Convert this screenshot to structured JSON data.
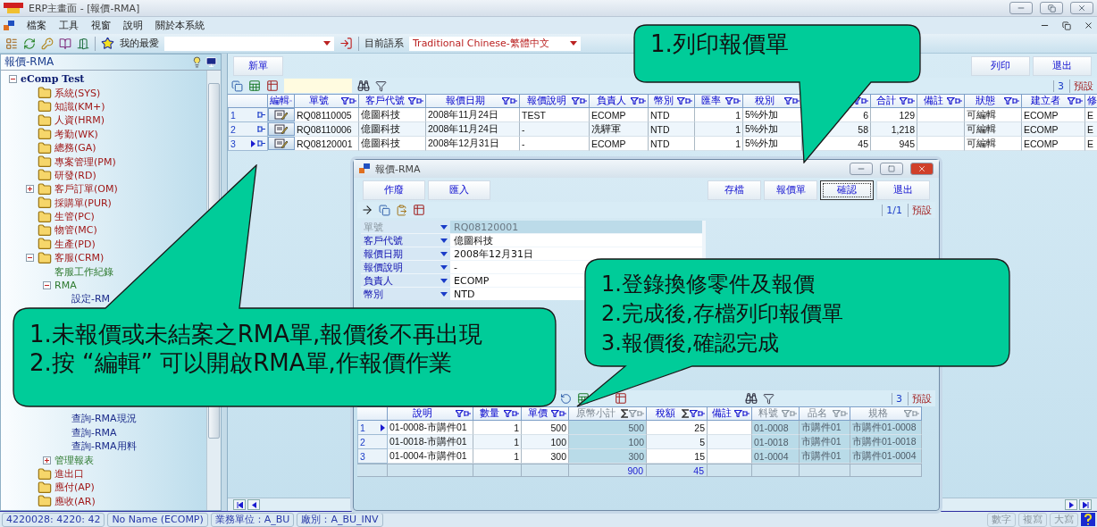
{
  "window": {
    "title": "ERP主畫面 - [報價-RMA]"
  },
  "menu": [
    "檔案",
    "工具",
    "視窗",
    "說明",
    "關於本系統"
  ],
  "toolbar": {
    "favorites_label": "我的最愛",
    "language_label": "目前語系",
    "language": "Traditional Chinese-繁體中文"
  },
  "sidebar": {
    "title": "報價-RMA",
    "tree": [
      {
        "label": "eComp Test",
        "expanded": true,
        "children": [
          {
            "label": "系統(SYS)"
          },
          {
            "label": "知識(KM+)"
          },
          {
            "label": "人資(HRM)"
          },
          {
            "label": "考勤(WK)"
          },
          {
            "label": "總務(GA)"
          },
          {
            "label": "專案管理(PM)"
          },
          {
            "label": "研發(RD)"
          },
          {
            "label": "客戶訂單(OM)",
            "expanded": false
          },
          {
            "label": "採購單(PUR)"
          },
          {
            "label": "生管(PC)"
          },
          {
            "label": "物管(MC)"
          },
          {
            "label": "生產(PD)"
          },
          {
            "label": "客服(CRM)",
            "expanded": true,
            "children": [
              {
                "label": "客服工作紀錄"
              },
              {
                "label": "RMA",
                "expanded": true,
                "children": [
                  {
                    "label": "設定-RM"
                  }
                ]
              }
            ]
          }
        ]
      }
    ],
    "tree_continued": [
      {
        "children": [
          {
            "children": [
              {
                "label": "查詢-RMA現況"
              },
              {
                "label": "查詢-RMA"
              },
              {
                "label": "查詢-RMA用料"
              }
            ]
          },
          {
            "label": "管理報表",
            "expanded": false
          }
        ]
      },
      {
        "label": "進出口"
      },
      {
        "label": "應付(AP)"
      },
      {
        "label": "應收(AR)"
      }
    ]
  },
  "main": {
    "buttons_left": [
      "新單"
    ],
    "buttons_right": [
      "列印",
      "退出"
    ],
    "count": "3",
    "layout": "預設",
    "edit_column": {
      "label": "編輯"
    },
    "columns": [
      {
        "label": "單號"
      },
      {
        "label": "客戶代號"
      },
      {
        "label": "報價日期"
      },
      {
        "label": "報價說明"
      },
      {
        "label": "負責人"
      },
      {
        "label": "幣別"
      },
      {
        "label": "匯率",
        "kind": "number"
      },
      {
        "label": "稅別"
      },
      {
        "kind": "number"
      },
      {
        "label": "合計",
        "kind": "number"
      },
      {
        "label": "備註"
      },
      {
        "label": "狀態"
      },
      {
        "label": "建立者"
      },
      {
        "label": "修"
      }
    ],
    "rows": [
      {
        "number": "1",
        "selected": false,
        "cells": [
          "RQ08110005",
          "億圖科技",
          "2008年11月24日",
          "TEST",
          "ECOMP",
          "NTD",
          "1",
          "5%外加",
          "6",
          "129",
          null,
          "可編輯",
          "ECOMP",
          "E"
        ]
      },
      {
        "number": "2",
        "selected": false,
        "cells": [
          "RQ08110006",
          "億圖科技",
          "2008年11月24日",
          "-",
          "冼驊軍",
          "NTD",
          "1",
          "5%外加",
          "58",
          "1,218",
          null,
          "可編輯",
          "ECOMP",
          "E"
        ]
      },
      {
        "number": "3",
        "selected": true,
        "cells": [
          "RQ08120001",
          "億圖科技",
          "2008年12月31日",
          "-",
          "ECOMP",
          "NTD",
          "1",
          "5%外加",
          "45",
          "945",
          null,
          "可編輯",
          "ECOMP",
          "E"
        ]
      }
    ]
  },
  "dialog": {
    "title": "報價-RMA",
    "buttons_left": [
      "作廢",
      "匯入"
    ],
    "buttons_right": [
      {
        "label": "存檔",
        "focused": false
      },
      {
        "label": "報價單",
        "focused": false
      },
      {
        "label": "確認",
        "focused": true
      },
      {
        "label": "退出",
        "focused": false
      }
    ],
    "position": "1/1",
    "layout": "預設",
    "fields": [
      {
        "label": "單號",
        "value": "RQ08120001",
        "disabled": true
      },
      {
        "label": "客戶代號",
        "value": "億圖科技",
        "disabled": false
      },
      {
        "label": "報價日期",
        "value": "2008年12月31日",
        "disabled": false
      },
      {
        "label": "報價說明",
        "value": "-",
        "disabled": false
      },
      {
        "label": "負責人",
        "value": "ECOMP",
        "disabled": false
      },
      {
        "label": "幣別",
        "value": "NTD",
        "disabled": false
      }
    ],
    "detail": {
      "count": "3",
      "layout": "預設",
      "columns": [
        {
          "label": "說明"
        },
        {
          "label": "數量",
          "kind": "number"
        },
        {
          "label": "單價",
          "kind": "number"
        },
        {
          "label": "原幣小計",
          "kind": "number",
          "readonly": true,
          "summed": true,
          "total": "900"
        },
        {
          "label": "稅額",
          "kind": "number",
          "summed": true,
          "total": "45"
        },
        {
          "label": "備註"
        },
        {
          "label": "料號",
          "readonly": true
        },
        {
          "label": "品名",
          "readonly": true
        },
        {
          "label": "規格",
          "readonly": true
        }
      ],
      "rows": [
        {
          "number": "1",
          "selected": true,
          "cells": [
            "01-0008-市購件01",
            "1",
            "500",
            "500",
            "25",
            null,
            "01-0008",
            "市購件01",
            "市購件01-0008"
          ]
        },
        {
          "number": "2",
          "selected": false,
          "cells": [
            "01-0018-市購件01",
            "1",
            "100",
            "100",
            "5",
            null,
            "01-0018",
            "市購件01",
            "市購件01-0018"
          ]
        },
        {
          "number": "3",
          "selected": false,
          "cells": [
            "01-0004-市購件01",
            "1",
            "300",
            "300",
            "15",
            null,
            "01-0004",
            "市購件01",
            "市購件01-0004"
          ]
        }
      ]
    }
  },
  "status_bar": {
    "fields": [
      "4220028: 4220: 42",
      "No Name (ECOMP)",
      "業務單位：A_BU",
      "廠別：A_BU_INV"
    ],
    "indicators": [
      "數字",
      "複寫",
      "大寫"
    ]
  },
  "callouts": [
    {
      "lines": [
        "1.列印報價單"
      ]
    },
    {
      "lines": [
        "1.未報價或未結案之RMA單,報價後不再出現",
        "2.按 “編輯” 可以開啟RMA單,作報價作業"
      ]
    },
    {
      "lines": [
        "1.登錄換修零件及報價",
        "2.完成後,存檔列印報價單",
        "3.報價後,確認完成"
      ]
    }
  ]
}
